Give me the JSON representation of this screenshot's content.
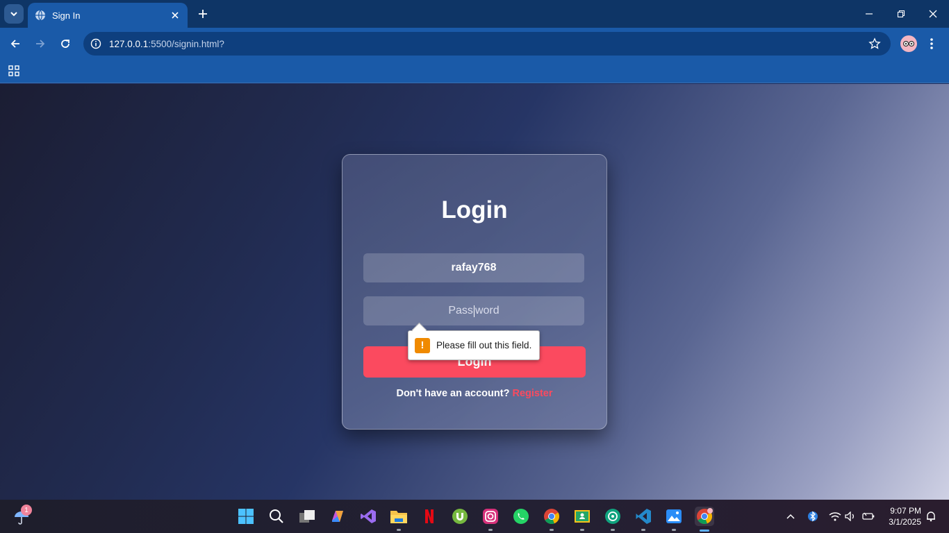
{
  "browser": {
    "tab_title": "Sign In",
    "url_host": "127.0.0.1",
    "url_path": ":5500/signin.html?",
    "icons": {
      "tab_search": "chevron-down-icon",
      "tab_favicon": "globe-icon",
      "tab_close": "close-icon",
      "new_tab": "plus-icon",
      "back": "back-arrow-icon",
      "forward": "forward-arrow-icon",
      "reload": "reload-icon",
      "site_info": "info-icon",
      "bookmark": "star-icon",
      "profile": "profile-avatar-icon",
      "menu": "kebab-menu-icon",
      "apps": "apps-grid-icon"
    }
  },
  "page": {
    "title": "Login",
    "username_value": "rafay768",
    "password_placeholder_before": "Pass",
    "password_placeholder_after": "word",
    "login_button": "Login",
    "register_prompt": "Don't have an account?",
    "register_link": "Register",
    "validation_tooltip": "Please fill out this field.",
    "colors": {
      "accent": "#fb4a5f",
      "warning": "#f08a00"
    }
  },
  "taskbar": {
    "weather_badge": "1",
    "apps": [
      "start-icon",
      "search-icon",
      "task-view-icon",
      "copilot-icon",
      "visual-studio-icon",
      "file-explorer-icon",
      "netflix-icon",
      "utorrent-icon",
      "instagram-icon",
      "whatsapp-icon",
      "chrome-icon",
      "google-classroom-icon",
      "chatgpt-icon",
      "vscode-icon",
      "photos-icon",
      "chrome-profile-icon"
    ],
    "time": "9:07 PM",
    "date": "3/1/2025"
  }
}
